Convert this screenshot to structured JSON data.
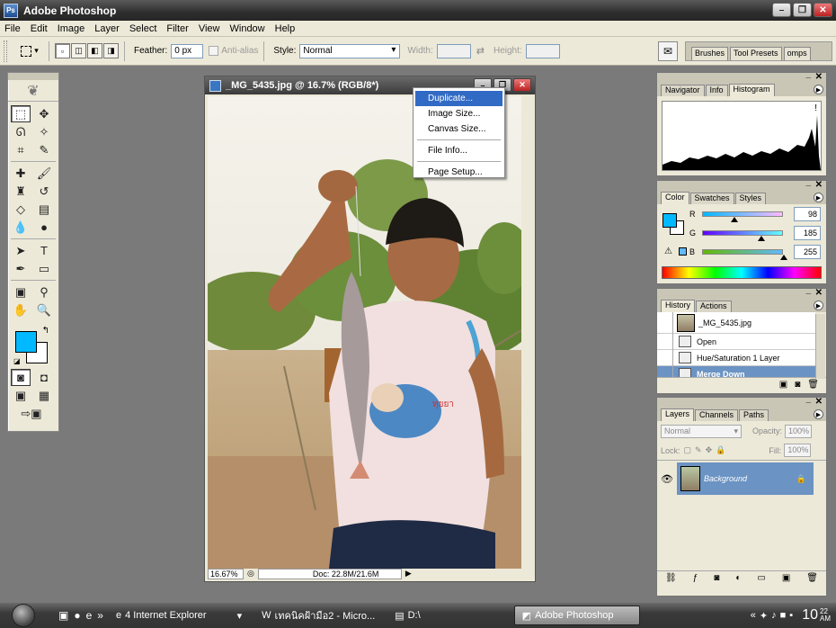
{
  "app": {
    "title": "Adobe Photoshop",
    "icon_label": "Ps"
  },
  "window_controls": [
    "–",
    "❐",
    "✕"
  ],
  "menu": [
    "File",
    "Edit",
    "Image",
    "Layer",
    "Select",
    "Filter",
    "View",
    "Window",
    "Help"
  ],
  "options": {
    "feather_label": "Feather:",
    "feather_value": "0 px",
    "antialias_label": "Anti-alias",
    "style_label": "Style:",
    "style_value": "Normal",
    "width_label": "Width:",
    "height_label": "Height:",
    "palette_well_tabs": [
      "Brushes",
      "Tool Presets",
      "omps"
    ]
  },
  "document": {
    "title": "_MG_5435.jpg @ 16.7% (RGB/8*)",
    "zoom": "16.67%",
    "doc_size": "Doc: 22.8M/21.6M"
  },
  "context_menu": {
    "items": [
      "Duplicate...",
      "Image Size...",
      "Canvas Size...",
      "File Info...",
      "Page Setup..."
    ]
  },
  "navigator_palette": {
    "tabs": [
      "Navigator",
      "Info",
      "Histogram"
    ],
    "warning_icon": "!"
  },
  "color_palette": {
    "tabs": [
      "Color",
      "Swatches",
      "Styles"
    ],
    "r_label": "R",
    "g_label": "G",
    "b_label": "B",
    "r": "98",
    "g": "185",
    "b": "255",
    "foreground_color": "#00b9ff",
    "background_color": "#ffffff"
  },
  "history_palette": {
    "tabs": [
      "History",
      "Actions"
    ],
    "snapshot": "_MG_5435.jpg",
    "states": [
      "Open",
      "Hue/Saturation 1 Layer",
      "Merge Down"
    ]
  },
  "layers_palette": {
    "tabs": [
      "Layers",
      "Channels",
      "Paths"
    ],
    "blend_mode": "Normal",
    "opacity_label": "Opacity:",
    "opacity": "100%",
    "lock_label": "Lock:",
    "fill_label": "Fill:",
    "fill": "100%",
    "layer_name": "Background"
  },
  "taskbar": {
    "tasks": [
      "4 Internet Explorer",
      "เทคนิคฝ้ามือ2 - Micro...",
      "D:\\",
      "Adobe Photoshop"
    ],
    "clock_hour": "10",
    "clock_min": "22",
    "clock_ampm": "AM"
  }
}
